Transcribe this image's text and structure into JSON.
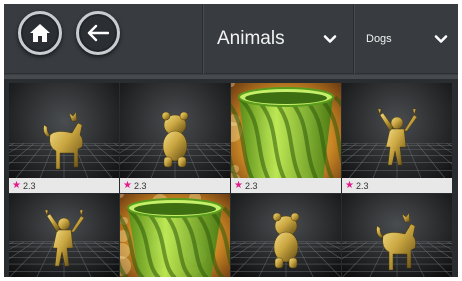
{
  "toolbar": {
    "home_icon": "home-icon",
    "back_icon": "arrow-left-icon"
  },
  "dropdowns": {
    "category": {
      "selected": "Animals",
      "icon": "chevron-down-icon"
    },
    "subcategory": {
      "selected": "Dogs",
      "icon": "chevron-down-icon"
    }
  },
  "grid": {
    "rows": [
      [
        {
          "model": "dog",
          "rating": "2.3"
        },
        {
          "model": "bear",
          "rating": "2.3"
        },
        {
          "model": "vase",
          "rating": "2.3"
        },
        {
          "model": "figure",
          "rating": "2.3"
        }
      ],
      [
        {
          "model": "figure",
          "rating": ""
        },
        {
          "model": "vase",
          "rating": ""
        },
        {
          "model": "bear",
          "rating": ""
        },
        {
          "model": "dog",
          "rating": ""
        }
      ]
    ]
  },
  "colors": {
    "star": "#e51b8b",
    "toolbar": "#383c40",
    "gold": "#c9a640",
    "green": "#9ed63a"
  }
}
